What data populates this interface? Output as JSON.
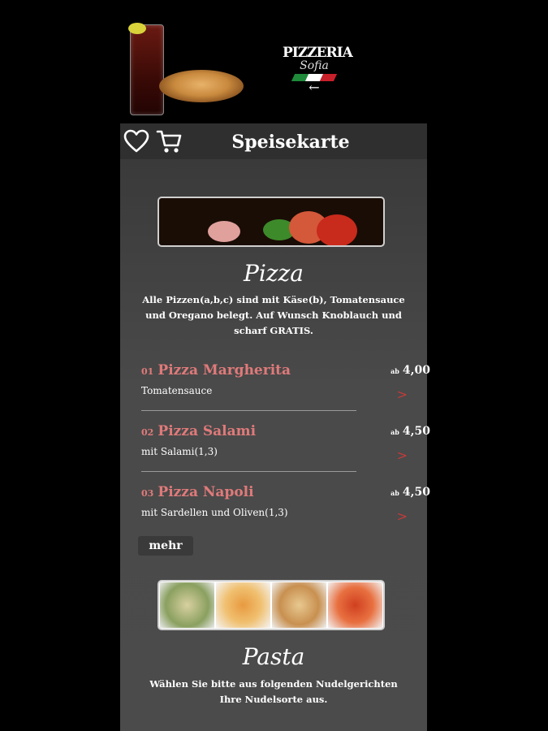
{
  "header": {
    "logo_title": "PIZZERIA",
    "logo_subtitle": "Sofia",
    "logo_arrow": "←",
    "flag_colors": [
      "#1f8a3a",
      "#ffffff",
      "#c8202a"
    ]
  },
  "navbar": {
    "title": "Speisekarte",
    "icons": [
      "heart-icon",
      "cart-icon"
    ]
  },
  "pizza_section": {
    "title": "Pizza",
    "description_line1": "Alle Pizzen(a,b,c) sind mit Käse(b), Tomatensauce",
    "description_line2": "und Oregano belegt. Auf Wunsch Knoblauch und",
    "description_line3": "scharf GRATIS.",
    "items": [
      {
        "num": "01",
        "name": "Pizza Margherita",
        "desc": "Tomatensauce",
        "price_prefix": "ab",
        "price": "4,00",
        "chevron": ">"
      },
      {
        "num": "02",
        "name": "Pizza Salami",
        "desc": "mit Salami(1,3)",
        "price_prefix": "ab",
        "price": "4,50",
        "chevron": ">"
      },
      {
        "num": "03",
        "name": "Pizza Napoli",
        "desc": "mit Sardellen und Oliven(1,3)",
        "price_prefix": "ab",
        "price": "4,50",
        "chevron": ">"
      }
    ],
    "more_label": "mehr"
  },
  "pasta_section": {
    "title": "Pasta",
    "description_line1": "Wählen Sie bitte aus folgenden Nudelgerichten",
    "description_line2": "Ihre Nudelsorte aus."
  },
  "colors": {
    "accent": "#e07a7a",
    "chevron": "#c83a3a",
    "navbar_bg": "#2f2f2f"
  }
}
